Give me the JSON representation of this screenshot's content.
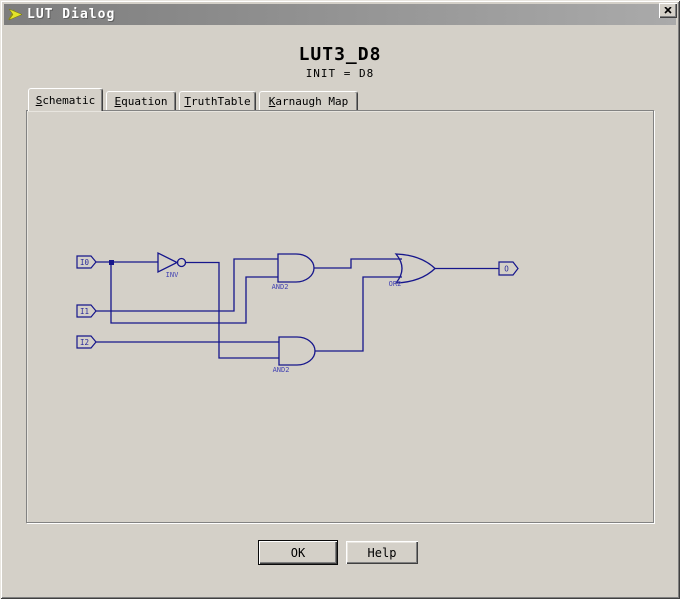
{
  "window": {
    "title": "LUT Dialog"
  },
  "header": {
    "title": "LUT3_D8",
    "subtitle": "INIT = D8"
  },
  "tabs": [
    {
      "accesskey": "S",
      "rest": "chematic"
    },
    {
      "accesskey": "E",
      "rest": "quation"
    },
    {
      "accesskey": "T",
      "rest": "ruthTable"
    },
    {
      "accesskey": "K",
      "rest": "arnaugh Map"
    }
  ],
  "schematic": {
    "inputs": {
      "i0": "I0",
      "i1": "I1",
      "i2": "I2"
    },
    "output": "O",
    "gates": {
      "inv": "INV",
      "and_top": "AND2",
      "and_bottom": "AND2",
      "or": "OR2"
    },
    "wire_color": "#16168c",
    "label_color": "#4343b2",
    "pin_text_color": "#2a2a9a"
  },
  "buttons": {
    "ok": "OK",
    "help": "Help"
  }
}
